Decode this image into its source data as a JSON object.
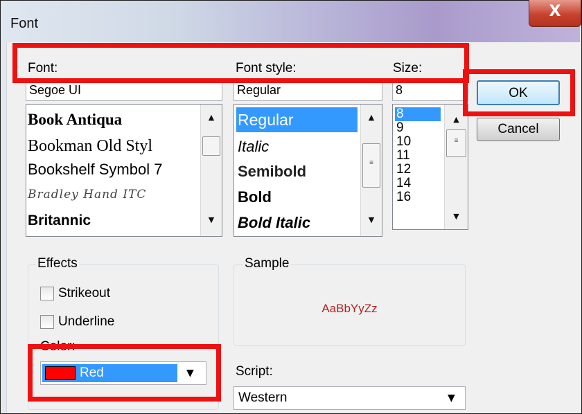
{
  "window": {
    "title": "Font",
    "close_glyph": "X"
  },
  "font": {
    "label": "Font:",
    "value": "Segoe UI",
    "items": [
      "Book Antiqua",
      "Bookman Old Styl",
      "Bookshelf Symbol 7",
      "Bradley Hand ITC",
      "Britannic"
    ]
  },
  "style": {
    "label": "Font style:",
    "value": "Regular",
    "items": [
      "Regular",
      "Italic",
      "Semibold",
      "Bold",
      "Bold Italic"
    ],
    "selected": "Regular"
  },
  "size": {
    "label": "Size:",
    "value": "8",
    "items": [
      "8",
      "9",
      "10",
      "11",
      "12",
      "14",
      "16"
    ],
    "selected": "8"
  },
  "buttons": {
    "ok": "OK",
    "cancel": "Cancel"
  },
  "effects": {
    "legend": "Effects",
    "strikeout": "Strikeout",
    "underline": "Underline",
    "color_label": "Color:",
    "color_value": "Red",
    "color_swatch": "#ff0000"
  },
  "sample": {
    "legend": "Sample",
    "text": "AaBbYyZz",
    "text_color": "#b22222"
  },
  "script": {
    "label": "Script:",
    "value": "Western"
  },
  "highlight_color": "#ee1111",
  "selection_color": "#3399ff"
}
